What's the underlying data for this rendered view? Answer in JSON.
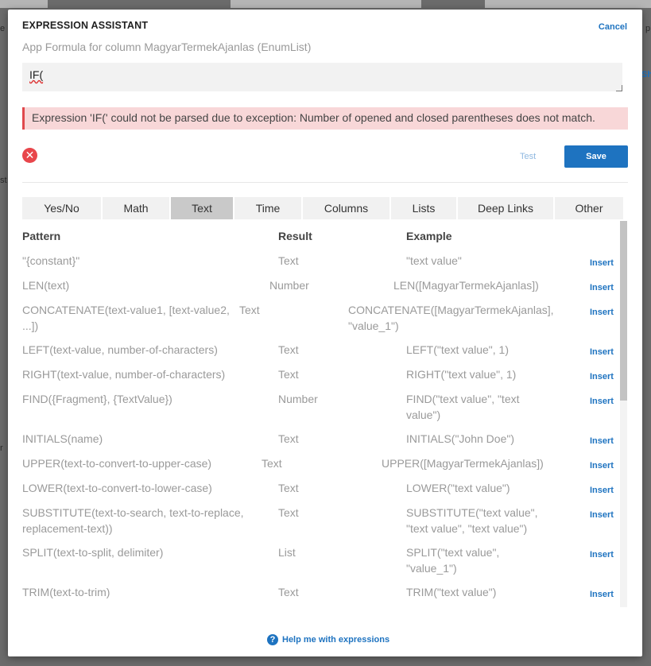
{
  "background": {
    "left_fragments": [
      "e",
      "st",
      "r"
    ],
    "right_fragments": [
      "p",
      "Sh"
    ]
  },
  "modal": {
    "title": "EXPRESSION ASSISTANT",
    "cancel_label": "Cancel",
    "subtitle": "App Formula for column MagyarTermekAjanlas (EnumList)",
    "expression_value": "IF(",
    "error_message": "Expression 'IF(' could not be parsed due to exception: Number of opened and closed parentheses does not match.",
    "test_label": "Test",
    "save_label": "Save",
    "help_label": "Help me with expressions"
  },
  "tabs": [
    {
      "label": "Yes/No",
      "active": false
    },
    {
      "label": "Math",
      "active": false
    },
    {
      "label": "Text",
      "active": true
    },
    {
      "label": "Time",
      "active": false
    },
    {
      "label": "Columns",
      "active": false
    },
    {
      "label": "Lists",
      "active": false
    },
    {
      "label": "Deep Links",
      "active": false
    },
    {
      "label": "Other",
      "active": false
    }
  ],
  "table": {
    "headers": {
      "pattern": "Pattern",
      "result": "Result",
      "example": "Example"
    },
    "insert_label": "Insert",
    "rows": [
      {
        "pattern": "\"{constant}\"",
        "result": "Text",
        "example": "\"text value\""
      },
      {
        "pattern": "LEN(text)",
        "result": "Number",
        "example": "LEN([MagyarTermekAjanlas])"
      },
      {
        "pattern": "CONCATENATE(text-value1, [text-value2, ...])",
        "result": "Text",
        "example": "CONCATENATE([MagyarTermekAjanlas], \"value_1\")"
      },
      {
        "pattern": "LEFT(text-value, number-of-characters)",
        "result": "Text",
        "example": "LEFT(\"text value\", 1)"
      },
      {
        "pattern": "RIGHT(text-value, number-of-characters)",
        "result": "Text",
        "example": "RIGHT(\"text value\", 1)"
      },
      {
        "pattern": "FIND({Fragment}, {TextValue})",
        "result": "Number",
        "example": "FIND(\"text value\", \"text value\")"
      },
      {
        "pattern": "INITIALS(name)",
        "result": "Text",
        "example": "INITIALS(\"John Doe\")"
      },
      {
        "pattern": "UPPER(text-to-convert-to-upper-case)",
        "result": "Text",
        "example": "UPPER([MagyarTermekAjanlas])"
      },
      {
        "pattern": "LOWER(text-to-convert-to-lower-case)",
        "result": "Text",
        "example": "LOWER(\"text value\")"
      },
      {
        "pattern": "SUBSTITUTE(text-to-search, text-to-replace, replacement-text))",
        "result": "Text",
        "example": "SUBSTITUTE(\"text value\", \"text value\", \"text value\")"
      },
      {
        "pattern": "SPLIT(text-to-split, delimiter)",
        "result": "List",
        "example": "SPLIT(\"text value\", \"value_1\")"
      },
      {
        "pattern": "TRIM(text-to-trim)",
        "result": "Text",
        "example": "TRIM(\"text value\")"
      }
    ]
  }
}
